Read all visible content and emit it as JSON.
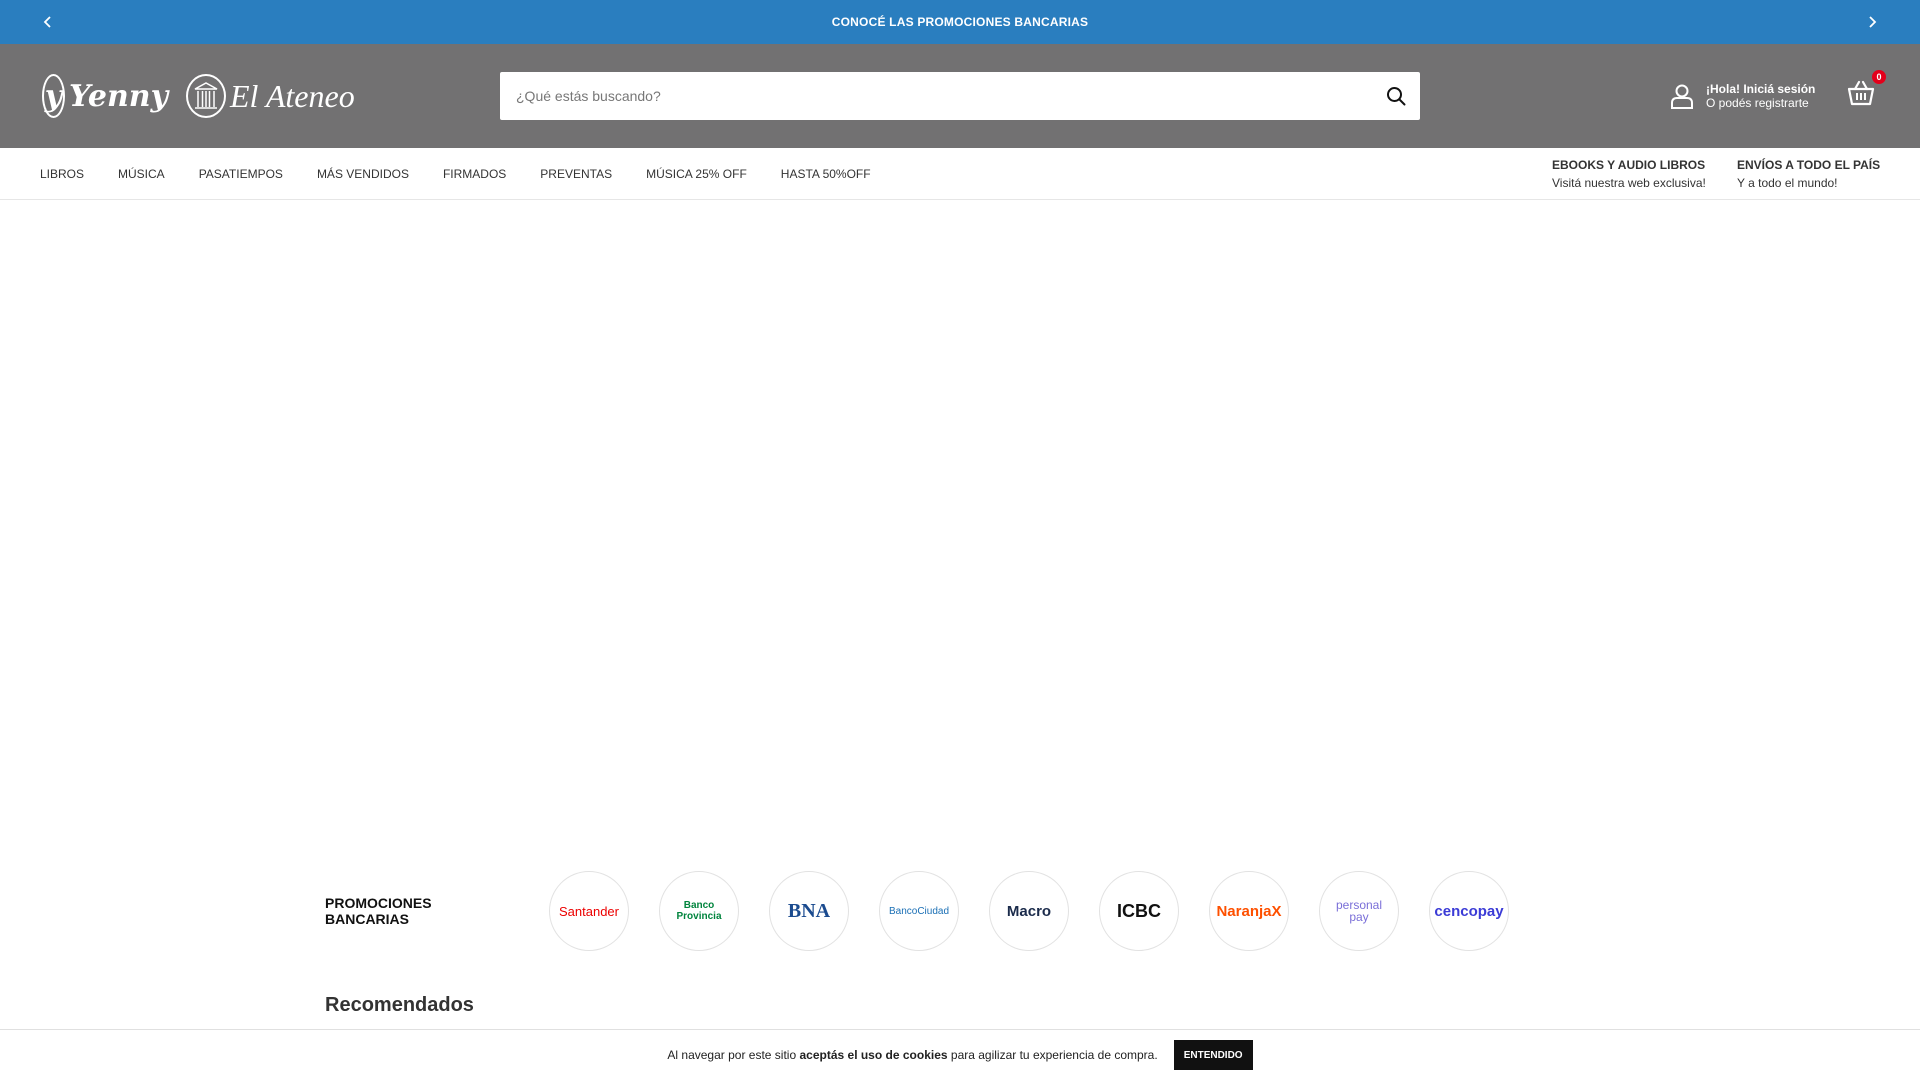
{
  "promo_bar": {
    "text": "CONOCÉ LAS PROMOCIONES BANCARIAS",
    "background": "#2a7ebf",
    "prev_icon": "chevron-left-icon",
    "next_icon": "chevron-right-icon"
  },
  "header": {
    "background": "#727172",
    "logos": {
      "yenny": {
        "mark": "y",
        "word": "Yenny"
      },
      "ateneo": {
        "word": "El Ateneo",
        "icon": "columns-icon"
      }
    },
    "search": {
      "placeholder": "¿Qué estás buscando?",
      "value": "",
      "icon": "search-icon"
    },
    "account": {
      "line1": "¡Hola! Iniciá sesión",
      "line2": "O podés registrarte",
      "icon": "user-icon"
    },
    "cart": {
      "count": "0",
      "icon": "basket-icon",
      "badge_color": "#e3001b"
    }
  },
  "nav": {
    "items": [
      "LIBROS",
      "MÚSICA",
      "PASATIEMPOS",
      "MÁS VENDIDOS",
      "FIRMADOS",
      "PREVENTAS",
      "MÚSICA 25% OFF",
      "HASTA 50%OFF"
    ],
    "ebooks": {
      "title": "EBOOKS Y AUDIO LIBROS",
      "subtitle": "Visitá nuestra web exclusiva!"
    },
    "envios": {
      "title": "ENVÍOS A TODO EL PAÍS",
      "subtitle": "Y a todo el mundo!"
    }
  },
  "promociones": {
    "title": "PROMOCIONES BANCARIAS",
    "banks": [
      {
        "name": "Santander",
        "color": "#ec0000"
      },
      {
        "name": "Banco Provincia",
        "color": "#00843d"
      },
      {
        "name": "BNA",
        "color": "#1b4b8f"
      },
      {
        "name": "BancoCiudad",
        "color": "#1a6fb5"
      },
      {
        "name": "Macro",
        "color": "#1b2b4b"
      },
      {
        "name": "ICBC",
        "color": "#c4161c"
      },
      {
        "name": "NaranjaX",
        "color": "#fe5000"
      },
      {
        "name": "personal pay",
        "color": "#7a6fd8"
      },
      {
        "name": "cencopay",
        "color": "#3b3bd6"
      }
    ]
  },
  "recomendados": {
    "title": "Recomendados"
  },
  "cookie_banner": {
    "text_before": "Al navegar por este sitio ",
    "text_bold": "aceptás el uso de cookies",
    "text_after": " para agilizar tu experiencia de compra.",
    "button": "ENTENDIDO"
  }
}
